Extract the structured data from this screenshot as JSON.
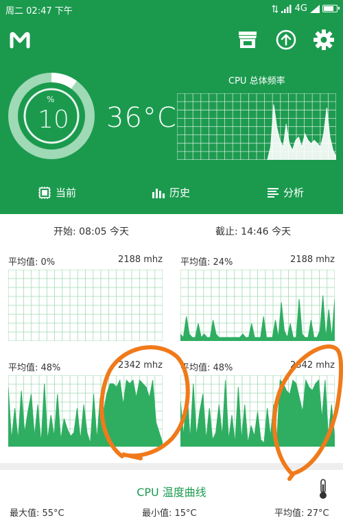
{
  "status_bar": {
    "day": "周二",
    "time": "02:47",
    "period": "下午",
    "network": "4G"
  },
  "header": {
    "logo": "M",
    "icons": [
      "store-icon",
      "upload-icon",
      "settings-gear-icon"
    ]
  },
  "gauge": {
    "unit": "%",
    "value": "10",
    "level": 0.1
  },
  "temperature": {
    "current": "36°C"
  },
  "total_freq": {
    "title": "CPU 总体频率",
    "values": [
      0,
      0,
      0,
      0,
      0,
      0,
      0,
      0,
      0,
      0,
      0,
      0,
      0,
      0,
      0,
      0,
      0,
      0,
      0,
      0,
      0,
      0,
      0,
      0,
      0,
      0,
      0,
      0,
      0,
      0,
      0.2,
      0.85,
      0.5,
      0.3,
      0.2,
      0.55,
      0.25,
      0.15,
      0.3,
      0.35,
      0.2,
      0.4,
      0.3,
      0.25,
      0.3,
      0.25,
      0.2,
      0.4,
      0.8,
      0.35,
      0.15,
      0.05
    ]
  },
  "tabs": [
    {
      "label": "当前",
      "icon": "cpu-chip-icon"
    },
    {
      "label": "历史",
      "icon": "bar-chart-icon"
    },
    {
      "label": "分析",
      "icon": "list-lines-icon"
    }
  ],
  "range": {
    "start": "开始: 08:05 今天",
    "end": "截止: 14:46 今天"
  },
  "cores": [
    {
      "avg": "平均值: 0%",
      "max": "2188 mhz",
      "values": []
    },
    {
      "avg": "平均值: 24%",
      "max": "2188 mhz",
      "values": [
        0.1,
        0.05,
        0.35,
        0.1,
        0.05,
        0.05,
        0.25,
        0.05,
        0.1,
        0.05,
        0.05,
        0.3,
        0.1,
        0.05,
        0.05,
        0.05,
        0.05,
        0.05,
        0.05,
        0.05,
        0.05,
        0.1,
        0.05,
        0.05,
        0.25,
        0.05,
        0.05,
        0.05,
        0.35,
        0.05,
        0.05,
        0.05,
        0.3,
        0.05,
        0.55,
        0.15,
        0.05,
        0.25,
        0.05,
        0.05,
        0.6,
        0.1,
        0.05,
        0.05,
        0.3,
        0.05,
        0.05,
        0.15,
        0.65,
        0.05,
        0.45,
        0.05,
        0.6
      ]
    },
    {
      "avg": "平均值: 48%",
      "max": "2342 mhz",
      "values": [
        0.85,
        0.1,
        0.55,
        0.1,
        0.8,
        0.2,
        0.5,
        0.75,
        0.15,
        0.6,
        0.05,
        0.9,
        0.1,
        0.45,
        0.15,
        0.75,
        0.1,
        0.4,
        0.25,
        0.15,
        0.2,
        0.55,
        0.1,
        0.6,
        0.2,
        0.05,
        0.75,
        0.1,
        0.7,
        0.5,
        0.75,
        0.9,
        0.9,
        0.85,
        0.95,
        0.6,
        0.95,
        0.9,
        0.95,
        0.7,
        0.95,
        0.9,
        0.85,
        0.7,
        0.95,
        0.35,
        0.2,
        0.05
      ]
    },
    {
      "avg": "平均值: 48%",
      "max": "2342 mhz",
      "values": [
        0.65,
        0.15,
        0.85,
        0.1,
        0.9,
        0.15,
        0.5,
        0.75,
        0.1,
        0.55,
        0.1,
        0.2,
        0.6,
        0.15,
        0.95,
        0.1,
        0.45,
        0.05,
        0.85,
        0.1,
        0.6,
        0.05,
        0.3,
        0.15,
        0.5,
        0.1,
        0.05,
        0.55,
        0.15,
        0.6,
        0.1,
        0.95,
        0.9,
        0.8,
        0.75,
        0.95,
        0.9,
        0.7,
        0.5,
        0.95,
        0.85,
        0.8,
        0.9,
        0.95,
        0.4,
        0.95,
        0.15,
        0.6,
        0.1
      ]
    }
  ],
  "temp_curve": {
    "title": "CPU 温度曲线",
    "max": "最大值: 55°C",
    "min": "最小值: 15°C",
    "avg": "平均值: 27°C"
  },
  "colors": {
    "brand_green": "#1b9a4e",
    "chart_fill": "#2fae62",
    "grid": "#9fd8b3",
    "annotation": "#f07a1a"
  }
}
